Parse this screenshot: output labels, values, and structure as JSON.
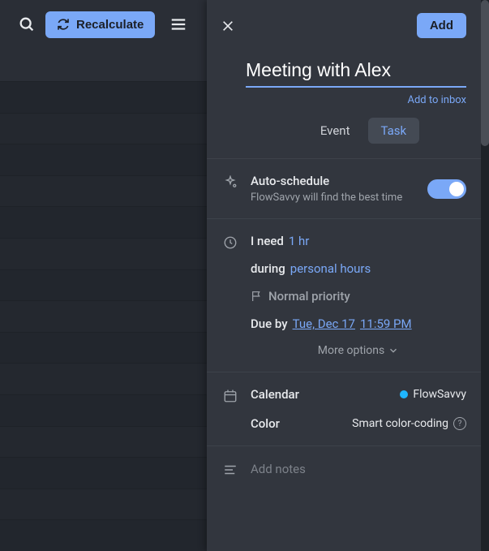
{
  "toolbar": {
    "recalculate_label": "Recalculate"
  },
  "panel": {
    "add_button": "Add",
    "title": "Meeting with Alex",
    "inbox_link": "Add to inbox",
    "tab_event": "Event",
    "tab_task": "Task",
    "autoschedule": {
      "title": "Auto-schedule",
      "subtitle": "FlowSavvy will find the best time"
    },
    "need_label": "I need",
    "need_value": "1 hr",
    "during_label": "during",
    "during_value": "personal hours",
    "priority": "Normal priority",
    "due_label": "Due by",
    "due_date": "Tue, Dec 17",
    "due_time": "11:59 PM",
    "more_options": "More options",
    "calendar_label": "Calendar",
    "calendar_name": "FlowSavvy",
    "color_label": "Color",
    "color_value": "Smart color-coding",
    "notes_placeholder": "Add notes"
  }
}
